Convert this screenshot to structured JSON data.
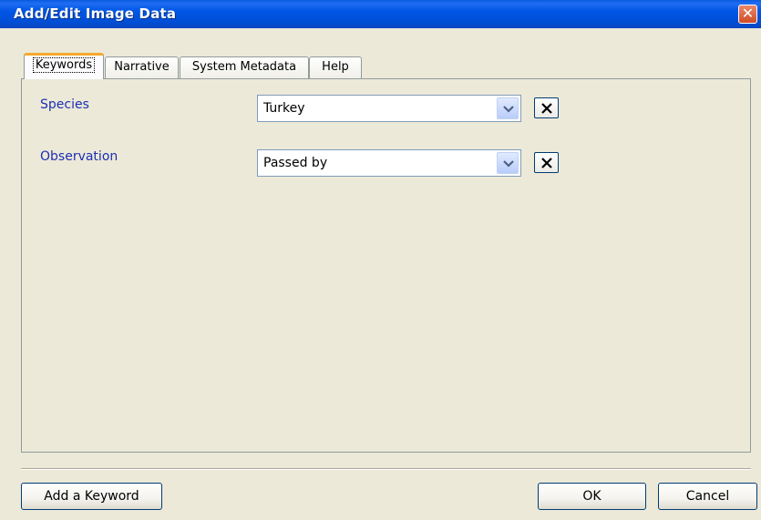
{
  "window": {
    "title": "Add/Edit Image Data",
    "close_icon": "close-icon"
  },
  "tabs": [
    {
      "label": "Keywords",
      "active": true
    },
    {
      "label": "Narrative",
      "active": false
    },
    {
      "label": "System Metadata",
      "active": false
    },
    {
      "label": "Help",
      "active": false
    }
  ],
  "keywords": [
    {
      "label": "Species",
      "value": "Turkey"
    },
    {
      "label": "Observation",
      "value": "Passed by"
    }
  ],
  "buttons": {
    "add_keyword": "Add a Keyword",
    "ok": "OK",
    "cancel": "Cancel"
  },
  "colors": {
    "titlebar": "#0055e5",
    "label": "#1c2fb3",
    "active_tab_accent": "#f4a92f",
    "close_button": "#d04c24"
  }
}
